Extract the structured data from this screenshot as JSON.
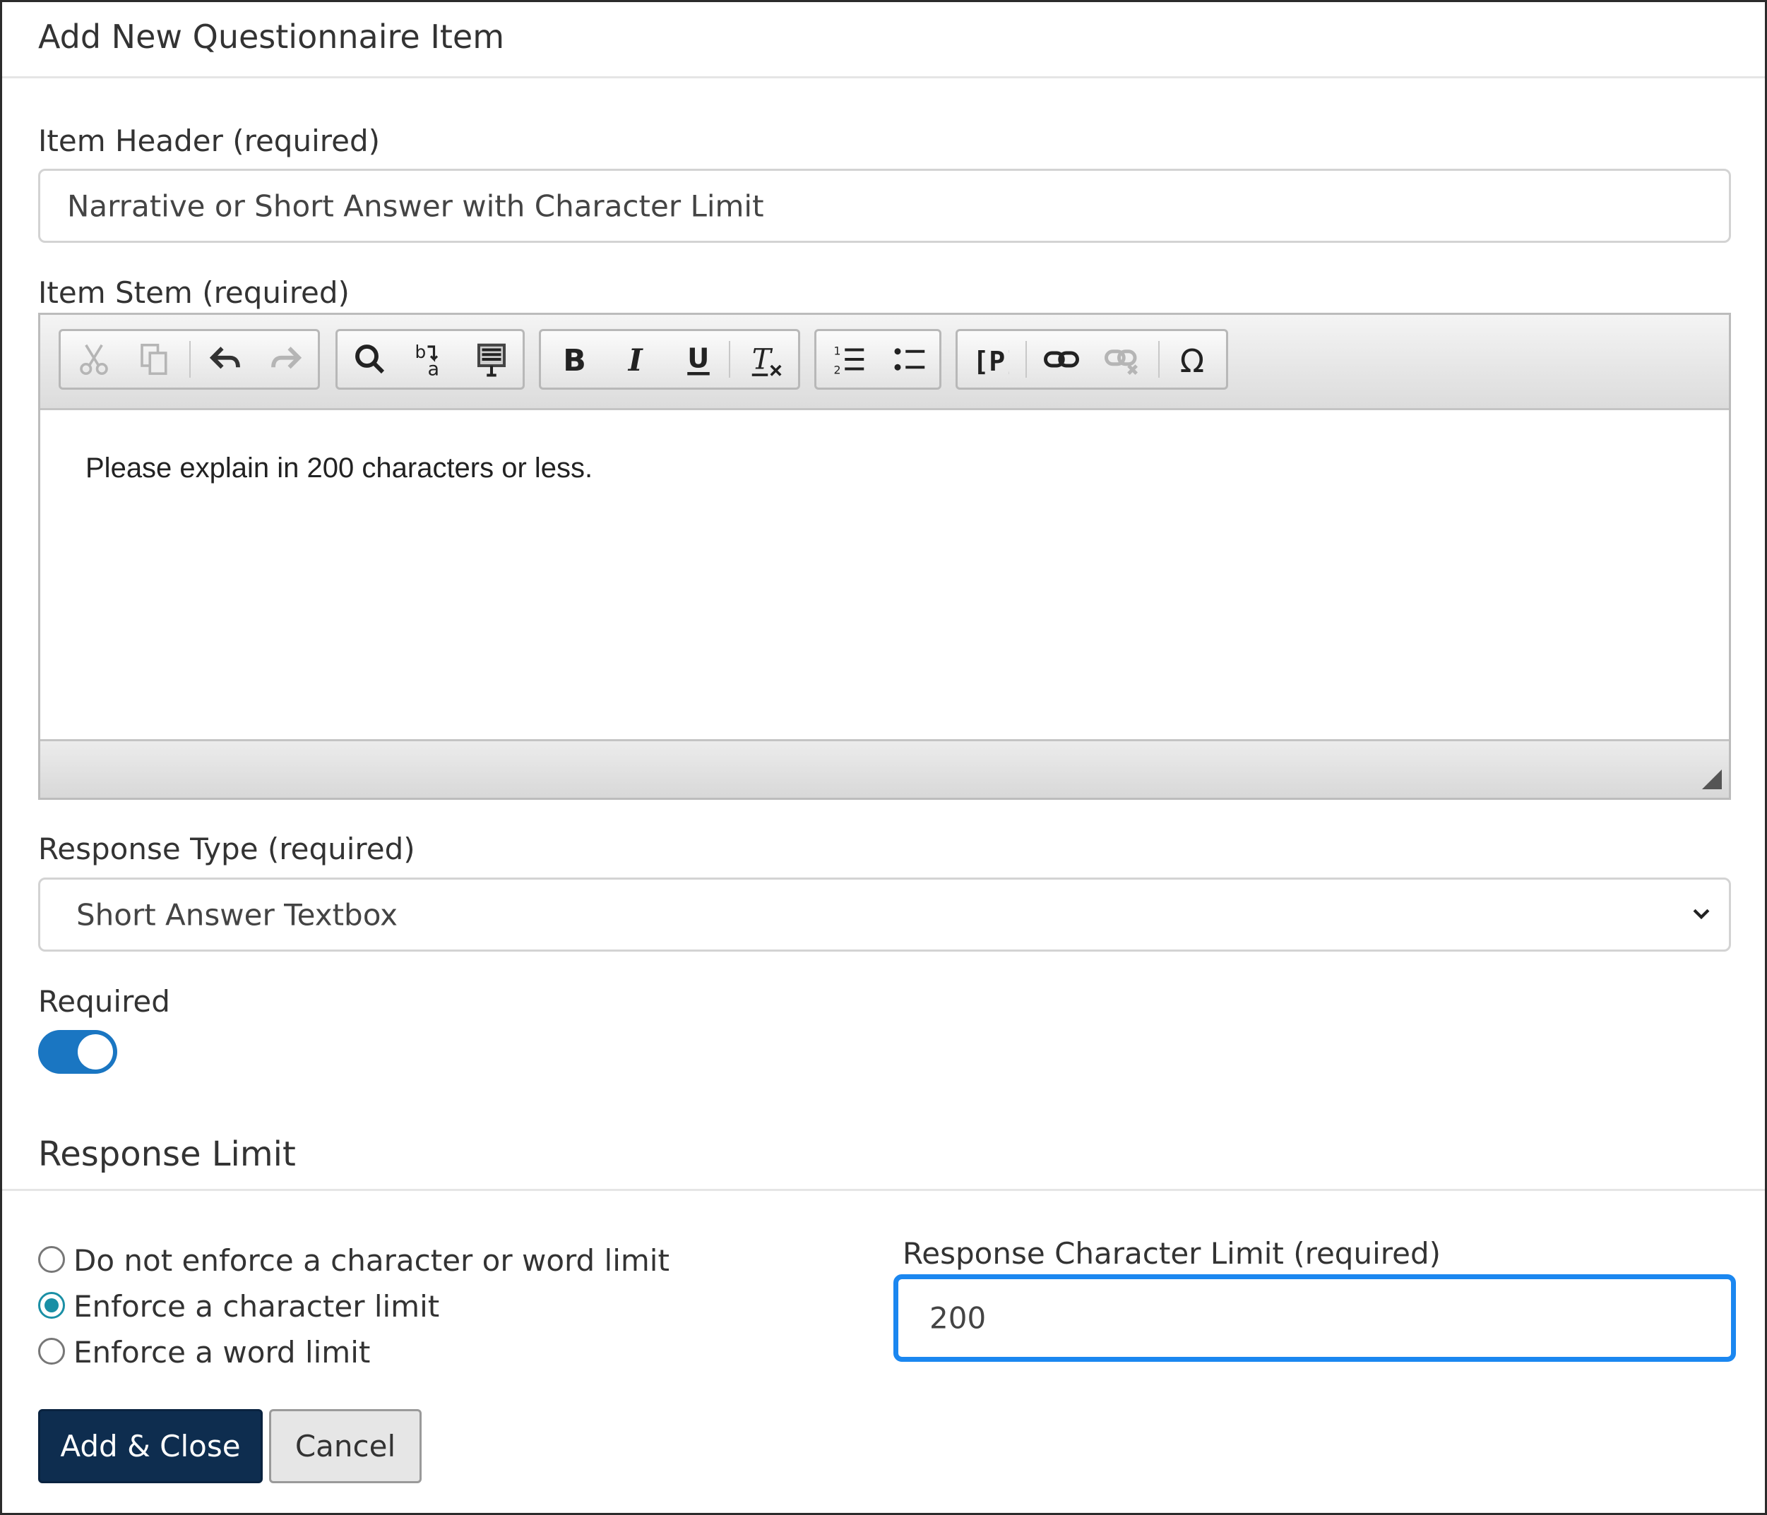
{
  "dialog": {
    "title": "Add New Questionnaire Item"
  },
  "item_header": {
    "label": "Item Header (required)",
    "value": "Narrative or Short Answer with Character Limit"
  },
  "item_stem": {
    "label": "Item Stem (required)",
    "content": "Please explain in 200 characters or less.",
    "toolbar_icons": [
      "cut-icon",
      "copy-icon",
      "undo-icon",
      "redo-icon",
      "find-icon",
      "replace-icon",
      "select-all-icon",
      "bold-icon",
      "italic-icon",
      "underline-icon",
      "remove-format-icon",
      "numbered-list-icon",
      "bulleted-list-icon",
      "piping-icon",
      "link-icon",
      "unlink-icon",
      "special-character-icon"
    ]
  },
  "response_type": {
    "label": "Response Type (required)",
    "selected": "Short Answer Textbox"
  },
  "required": {
    "label": "Required",
    "on": true
  },
  "response_limit": {
    "heading": "Response Limit",
    "options": [
      {
        "label": "Do not enforce a character or word limit",
        "checked": false
      },
      {
        "label": "Enforce a character limit",
        "checked": true
      },
      {
        "label": "Enforce a word limit",
        "checked": false
      }
    ],
    "char_limit_label": "Response Character Limit (required)",
    "char_limit_value": "200"
  },
  "buttons": {
    "add_close": "Add & Close",
    "cancel": "Cancel"
  },
  "colors": {
    "primary": "#0e2d4f",
    "toggle": "#1a76c2",
    "focus": "#1b87f0",
    "radio": "#1a8fa5"
  }
}
